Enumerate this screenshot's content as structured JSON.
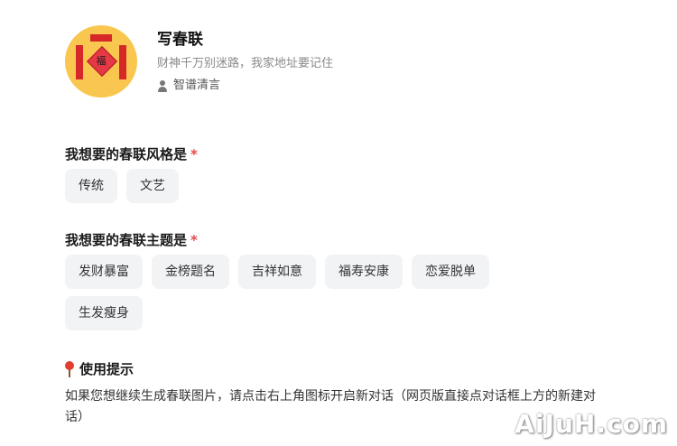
{
  "app": {
    "title": "写春联",
    "subtitle": "财神千万别迷路，我家地址要记住",
    "author": "智谱清言",
    "avatar_char": "福"
  },
  "style_section": {
    "label": "我想要的春联风格是",
    "required_mark": "*",
    "options": [
      "传统",
      "文艺"
    ]
  },
  "theme_section": {
    "label": "我想要的春联主题是",
    "required_mark": "*",
    "options": [
      "发财暴富",
      "金榜题名",
      "吉祥如意",
      "福寿安康",
      "恋爱脱单",
      "生发瘦身"
    ]
  },
  "tip": {
    "title": "使用提示",
    "text": "如果您想继续生成春联图片，请点击右上角图标开启新对话（网页版直接点对话框上方的新建对话）"
  },
  "watermark": "AiJuH.com"
}
